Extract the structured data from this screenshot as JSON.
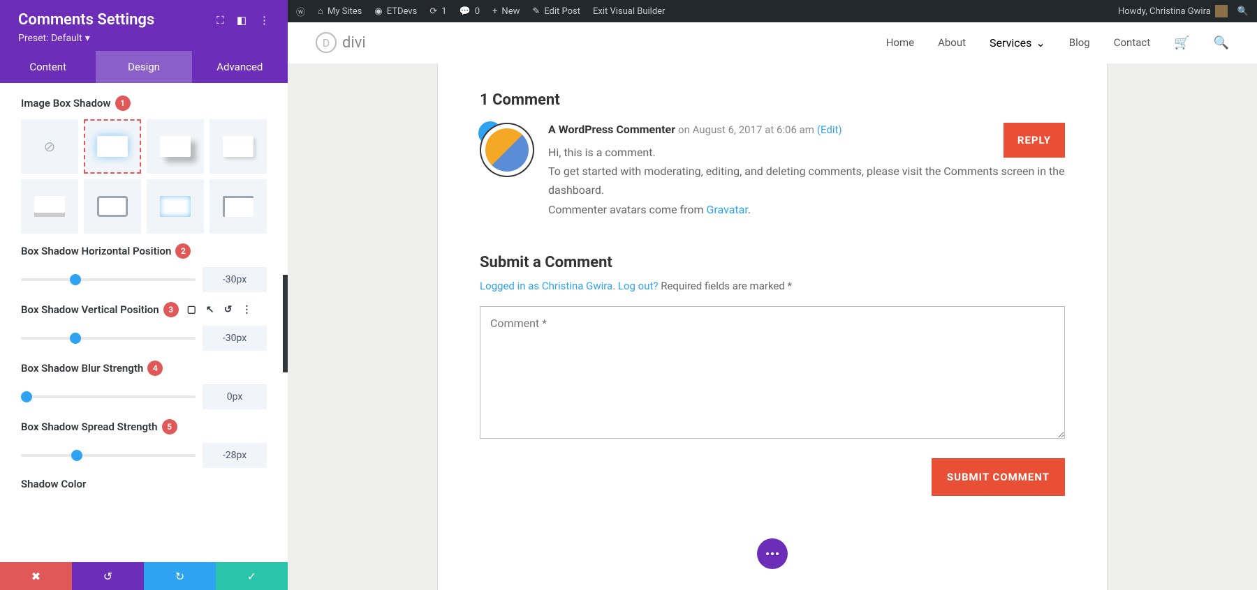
{
  "sidebar": {
    "title": "Comments Settings",
    "preset": "Preset: Default",
    "tabs": [
      "Content",
      "Design",
      "Advanced"
    ],
    "activeTab": 1,
    "labels": {
      "imageBoxShadow": "Image Box Shadow",
      "horizPos": "Box Shadow Horizontal Position",
      "vertPos": "Box Shadow Vertical Position",
      "blur": "Box Shadow Blur Strength",
      "spread": "Box Shadow Spread Strength",
      "color": "Shadow Color"
    },
    "badges": {
      "imageBoxShadow": "1",
      "horizPos": "2",
      "vertPos": "3",
      "blur": "4",
      "spread": "5"
    },
    "values": {
      "horizPos": "-30px",
      "vertPos": "-30px",
      "blur": "0px",
      "spread": "-28px"
    },
    "sliderPos": {
      "horizPos": 31,
      "vertPos": 31,
      "blur": 3,
      "spread": 32
    }
  },
  "adminbar": {
    "mySites": "My Sites",
    "etDevs": "ETDevs",
    "updates": "1",
    "comments": "0",
    "new": "New",
    "editPost": "Edit Post",
    "exitBuilder": "Exit Visual Builder",
    "howdy": "Howdy, Christina Gwira"
  },
  "nav": {
    "logo": "divi",
    "items": [
      "Home",
      "About",
      "Services",
      "Blog",
      "Contact"
    ]
  },
  "comments": {
    "title": "1 Comment",
    "author": "A WordPress Commenter",
    "date": "on August 6, 2017 at 6:06 am",
    "edit": "(Edit)",
    "line1": "Hi, this is a comment.",
    "line2": "To get started with moderating, editing, and deleting comments, please visit the Comments screen in the dashboard.",
    "line3a": "Commenter avatars come from ",
    "line3link": "Gravatar",
    "reply": "REPLY"
  },
  "form": {
    "title": "Submit a Comment",
    "loggedIn": "Logged in as Christina Gwira",
    "logout": "Log out?",
    "required": " Required fields are marked *",
    "placeholder": "Comment *",
    "submit": "SUBMIT COMMENT"
  }
}
